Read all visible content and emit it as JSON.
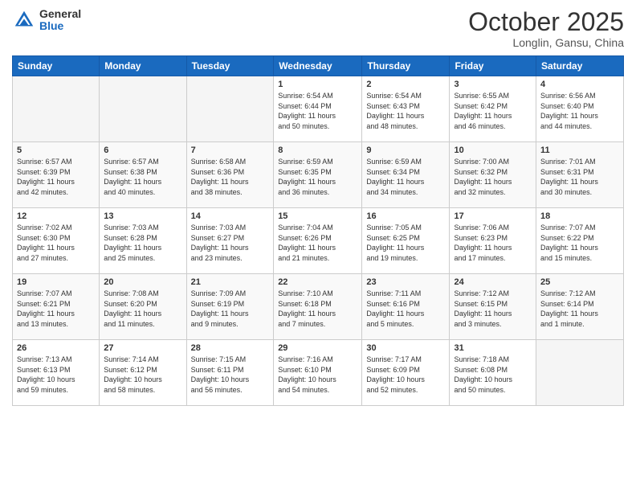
{
  "logo": {
    "general": "General",
    "blue": "Blue"
  },
  "title": "October 2025",
  "subtitle": "Longlin, Gansu, China",
  "days_of_week": [
    "Sunday",
    "Monday",
    "Tuesday",
    "Wednesday",
    "Thursday",
    "Friday",
    "Saturday"
  ],
  "weeks": [
    [
      {
        "day": "",
        "info": ""
      },
      {
        "day": "",
        "info": ""
      },
      {
        "day": "",
        "info": ""
      },
      {
        "day": "1",
        "info": "Sunrise: 6:54 AM\nSunset: 6:44 PM\nDaylight: 11 hours\nand 50 minutes."
      },
      {
        "day": "2",
        "info": "Sunrise: 6:54 AM\nSunset: 6:43 PM\nDaylight: 11 hours\nand 48 minutes."
      },
      {
        "day": "3",
        "info": "Sunrise: 6:55 AM\nSunset: 6:42 PM\nDaylight: 11 hours\nand 46 minutes."
      },
      {
        "day": "4",
        "info": "Sunrise: 6:56 AM\nSunset: 6:40 PM\nDaylight: 11 hours\nand 44 minutes."
      }
    ],
    [
      {
        "day": "5",
        "info": "Sunrise: 6:57 AM\nSunset: 6:39 PM\nDaylight: 11 hours\nand 42 minutes."
      },
      {
        "day": "6",
        "info": "Sunrise: 6:57 AM\nSunset: 6:38 PM\nDaylight: 11 hours\nand 40 minutes."
      },
      {
        "day": "7",
        "info": "Sunrise: 6:58 AM\nSunset: 6:36 PM\nDaylight: 11 hours\nand 38 minutes."
      },
      {
        "day": "8",
        "info": "Sunrise: 6:59 AM\nSunset: 6:35 PM\nDaylight: 11 hours\nand 36 minutes."
      },
      {
        "day": "9",
        "info": "Sunrise: 6:59 AM\nSunset: 6:34 PM\nDaylight: 11 hours\nand 34 minutes."
      },
      {
        "day": "10",
        "info": "Sunrise: 7:00 AM\nSunset: 6:32 PM\nDaylight: 11 hours\nand 32 minutes."
      },
      {
        "day": "11",
        "info": "Sunrise: 7:01 AM\nSunset: 6:31 PM\nDaylight: 11 hours\nand 30 minutes."
      }
    ],
    [
      {
        "day": "12",
        "info": "Sunrise: 7:02 AM\nSunset: 6:30 PM\nDaylight: 11 hours\nand 27 minutes."
      },
      {
        "day": "13",
        "info": "Sunrise: 7:03 AM\nSunset: 6:28 PM\nDaylight: 11 hours\nand 25 minutes."
      },
      {
        "day": "14",
        "info": "Sunrise: 7:03 AM\nSunset: 6:27 PM\nDaylight: 11 hours\nand 23 minutes."
      },
      {
        "day": "15",
        "info": "Sunrise: 7:04 AM\nSunset: 6:26 PM\nDaylight: 11 hours\nand 21 minutes."
      },
      {
        "day": "16",
        "info": "Sunrise: 7:05 AM\nSunset: 6:25 PM\nDaylight: 11 hours\nand 19 minutes."
      },
      {
        "day": "17",
        "info": "Sunrise: 7:06 AM\nSunset: 6:23 PM\nDaylight: 11 hours\nand 17 minutes."
      },
      {
        "day": "18",
        "info": "Sunrise: 7:07 AM\nSunset: 6:22 PM\nDaylight: 11 hours\nand 15 minutes."
      }
    ],
    [
      {
        "day": "19",
        "info": "Sunrise: 7:07 AM\nSunset: 6:21 PM\nDaylight: 11 hours\nand 13 minutes."
      },
      {
        "day": "20",
        "info": "Sunrise: 7:08 AM\nSunset: 6:20 PM\nDaylight: 11 hours\nand 11 minutes."
      },
      {
        "day": "21",
        "info": "Sunrise: 7:09 AM\nSunset: 6:19 PM\nDaylight: 11 hours\nand 9 minutes."
      },
      {
        "day": "22",
        "info": "Sunrise: 7:10 AM\nSunset: 6:18 PM\nDaylight: 11 hours\nand 7 minutes."
      },
      {
        "day": "23",
        "info": "Sunrise: 7:11 AM\nSunset: 6:16 PM\nDaylight: 11 hours\nand 5 minutes."
      },
      {
        "day": "24",
        "info": "Sunrise: 7:12 AM\nSunset: 6:15 PM\nDaylight: 11 hours\nand 3 minutes."
      },
      {
        "day": "25",
        "info": "Sunrise: 7:12 AM\nSunset: 6:14 PM\nDaylight: 11 hours\nand 1 minute."
      }
    ],
    [
      {
        "day": "26",
        "info": "Sunrise: 7:13 AM\nSunset: 6:13 PM\nDaylight: 10 hours\nand 59 minutes."
      },
      {
        "day": "27",
        "info": "Sunrise: 7:14 AM\nSunset: 6:12 PM\nDaylight: 10 hours\nand 58 minutes."
      },
      {
        "day": "28",
        "info": "Sunrise: 7:15 AM\nSunset: 6:11 PM\nDaylight: 10 hours\nand 56 minutes."
      },
      {
        "day": "29",
        "info": "Sunrise: 7:16 AM\nSunset: 6:10 PM\nDaylight: 10 hours\nand 54 minutes."
      },
      {
        "day": "30",
        "info": "Sunrise: 7:17 AM\nSunset: 6:09 PM\nDaylight: 10 hours\nand 52 minutes."
      },
      {
        "day": "31",
        "info": "Sunrise: 7:18 AM\nSunset: 6:08 PM\nDaylight: 10 hours\nand 50 minutes."
      },
      {
        "day": "",
        "info": ""
      }
    ]
  ]
}
